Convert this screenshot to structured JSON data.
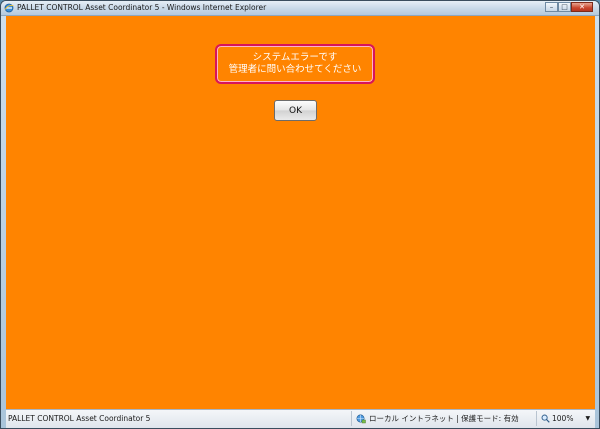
{
  "window": {
    "title": "PALLET CONTROL Asset Coordinator 5 - Windows Internet Explorer",
    "minimize_glyph": "–",
    "maximize_glyph": "□",
    "close_glyph": "✕"
  },
  "dialog": {
    "message_line1": "システムエラーです",
    "message_line2": "管理者に問い合わせてください",
    "ok_label": "OK"
  },
  "statusbar": {
    "left_text": "PALLET CONTROL Asset Coordinator 5",
    "zone_text": "ローカル イントラネット | 保護モード: 有効",
    "zoom_text": "100%",
    "zoom_arrow": "▼"
  },
  "colors": {
    "page_background": "#ff8400",
    "error_border": "#d8145a",
    "message_text": "#ffffff"
  }
}
